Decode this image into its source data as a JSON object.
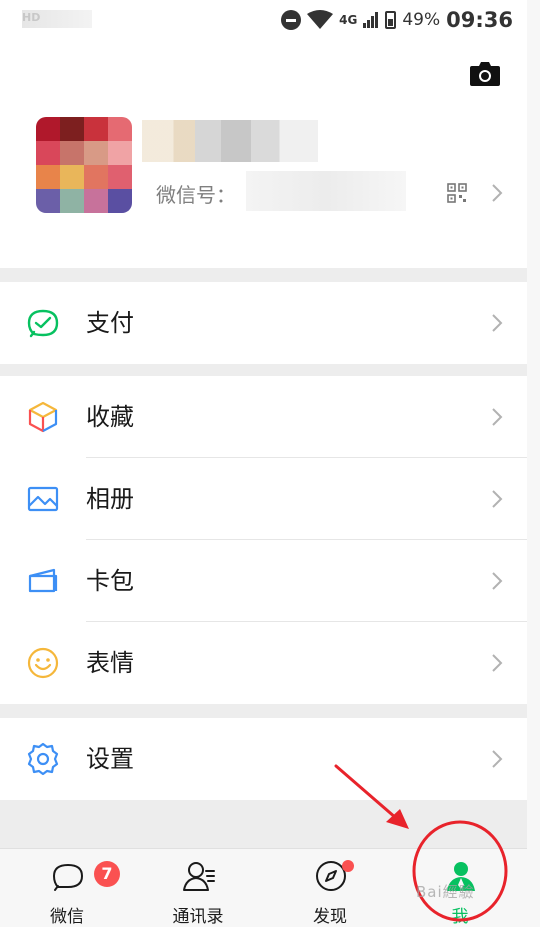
{
  "status_bar": {
    "left": "HD",
    "network": "4G",
    "battery": "49%",
    "time": "09:36"
  },
  "profile": {
    "wechat_id_label": "微信号："
  },
  "menu_groups": [
    [
      {
        "label": "支付",
        "icon": "pay-icon"
      }
    ],
    [
      {
        "label": "收藏",
        "icon": "favorites-icon"
      },
      {
        "label": "相册",
        "icon": "album-icon"
      },
      {
        "label": "卡包",
        "icon": "card-wallet-icon"
      },
      {
        "label": "表情",
        "icon": "sticker-icon"
      }
    ],
    [
      {
        "label": "设置",
        "icon": "settings-icon"
      }
    ]
  ],
  "tabbar": {
    "tabs": [
      {
        "label": "微信",
        "icon": "chat-icon",
        "badge": "7"
      },
      {
        "label": "通讯录",
        "icon": "contacts-icon"
      },
      {
        "label": "发现",
        "icon": "discover-compass-icon"
      },
      {
        "label": "我",
        "icon": "me-person-icon",
        "active": true
      }
    ]
  },
  "colors": {
    "brand_green": "#07c160",
    "badge_red": "#fa5151",
    "annotation_red": "#e8232b"
  }
}
